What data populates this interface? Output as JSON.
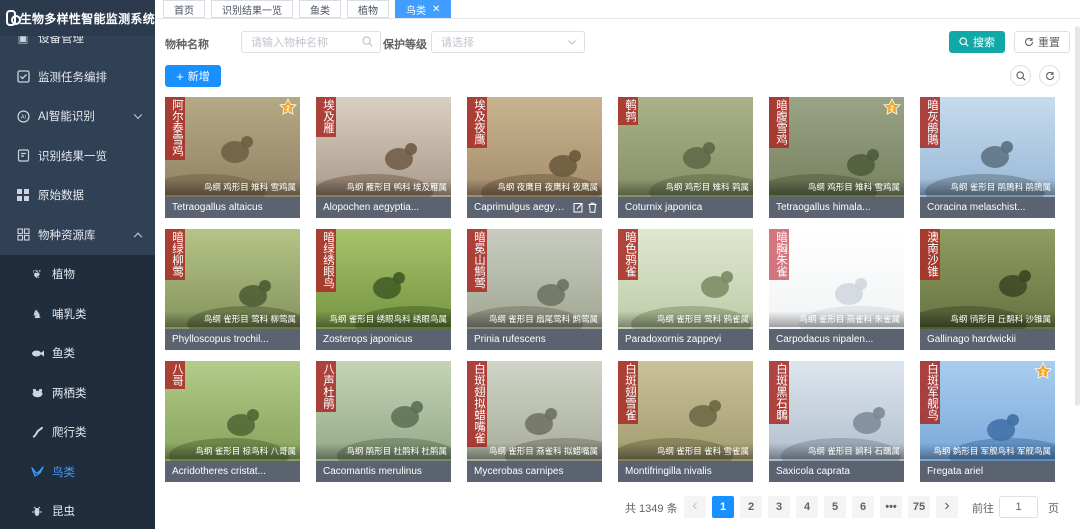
{
  "app": {
    "title": "生物多样性智能监测系统"
  },
  "sidebar": {
    "items": [
      {
        "label": "设备管理",
        "icon": "device-icon"
      },
      {
        "label": "监测任务编排",
        "icon": "task-check-icon"
      },
      {
        "label": "AI智能识别",
        "icon": "ai-icon",
        "expandable": true
      },
      {
        "label": "识别结果一览",
        "icon": "results-icon"
      },
      {
        "label": "原始数据",
        "icon": "grid-icon"
      },
      {
        "label": "物种资源库",
        "icon": "species-library-icon",
        "expanded": true
      }
    ],
    "subitems": [
      {
        "label": "植物",
        "icon": "plant-icon"
      },
      {
        "label": "哺乳类",
        "icon": "mammal-icon"
      },
      {
        "label": "鱼类",
        "icon": "fish-icon"
      },
      {
        "label": "两栖类",
        "icon": "amphibian-icon"
      },
      {
        "label": "爬行类",
        "icon": "reptile-icon"
      },
      {
        "label": "鸟类",
        "icon": "bird-icon",
        "active": true
      },
      {
        "label": "昆虫",
        "icon": "insect-icon"
      }
    ]
  },
  "tabs": [
    {
      "label": "首页"
    },
    {
      "label": "识别结果一览"
    },
    {
      "label": "鱼类"
    },
    {
      "label": "植物"
    },
    {
      "label": "鸟类",
      "active": true,
      "close": "✕"
    }
  ],
  "filters": {
    "species_label": "物种名称",
    "species_placeholder": "请输入物种名称",
    "level_label": "保护等级",
    "level_placeholder": "请选择",
    "search_button": "搜索",
    "reset_button": "重置",
    "add_button": "新增"
  },
  "cards": [
    {
      "cn": "阿尔泰雪鸡",
      "taxon": "鸟纲 鸡形目 雉科 雪鸡属",
      "latin": "Tetraogallus altaicus",
      "badge": true
    },
    {
      "cn": "埃及雁",
      "taxon": "鸟纲 雁形目 鸭科 埃及雁属",
      "latin": "Alopochen aegyptia..."
    },
    {
      "cn": "埃及夜鹰",
      "taxon": "鸟纲 夜鹰目 夜鹰科 夜鹰属",
      "latin": "Caprimulgus aegypt...",
      "hover": true
    },
    {
      "cn": "鹌鹑",
      "taxon": "鸟纲 鸡形目 雉科 鹑属",
      "latin": "Coturnix japonica"
    },
    {
      "cn": "暗腹雪鸡",
      "taxon": "鸟纲 鸡形目 雉科 雪鸡属",
      "latin": "Tetraogallus himala...",
      "badge": true
    },
    {
      "cn": "暗灰鹃鵙",
      "taxon": "鸟纲 雀形目 鹃鵙科 鹃鵙属",
      "latin": "Coracina melaschist..."
    },
    {
      "cn": "暗绿柳莺",
      "taxon": "鸟纲 雀形目 莺科 柳莺属",
      "latin": "Phylloscopus trochil..."
    },
    {
      "cn": "暗绿绣眼鸟",
      "taxon": "鸟纲 雀形目 绣眼鸟科 绣眼鸟属",
      "latin": "Zosterops japonicus"
    },
    {
      "cn": "暗冕山鹪莺",
      "taxon": "鸟纲 雀形目 扇尾莺科 鹪莺属",
      "latin": "Prinia rufescens"
    },
    {
      "cn": "暗色鸦雀",
      "taxon": "鸟纲 雀形目 莺科 鸦雀属",
      "latin": "Paradoxornis zappeyi"
    },
    {
      "cn": "暗胸朱雀",
      "taxon": "鸟纲 雀形目 燕雀科 朱雀属",
      "latin": "Carpodacus nipalen...",
      "light": true
    },
    {
      "cn": "澳南沙锥",
      "taxon": "鸟纲 鸻形目 丘鹬科 沙锥属",
      "latin": "Gallinago hardwickii"
    },
    {
      "cn": "八哥",
      "taxon": "鸟纲 雀形目 椋鸟科 八哥属",
      "latin": "Acridotheres cristat..."
    },
    {
      "cn": "八声杜鹃",
      "taxon": "鸟纲 鹃形目 杜鹃科 杜鹃属",
      "latin": "Cacomantis merulinus"
    },
    {
      "cn": "白斑翅拟蜡嘴雀",
      "taxon": "鸟纲 雀形目 燕雀科 拟蜡嘴属",
      "latin": "Mycerobas carnipes"
    },
    {
      "cn": "白斑翅雪雀",
      "taxon": "鸟纲 雀形目 雀科 雪雀属",
      "latin": "Montifringilla nivalis"
    },
    {
      "cn": "白斑黑石䳭",
      "taxon": "鸟纲 雀形目 鹟科 石䳭属",
      "latin": "Saxicola caprata"
    },
    {
      "cn": "白斑军舰鸟",
      "taxon": "鸟纲 鹈形目 军舰鸟科 军舰鸟属",
      "latin": "Fregata ariel",
      "badge": true
    }
  ],
  "pagination": {
    "total_text": "共 1349 条",
    "pages": [
      "1",
      "2",
      "3",
      "4",
      "5",
      "6",
      "•••",
      "75"
    ],
    "current": "1",
    "goto_label": "前往",
    "goto_value": "1",
    "unit_label": "页"
  },
  "colors": {
    "sidebar_bg": "#304156",
    "accent": "#409eff",
    "search_button": "#13a8a8",
    "name_tag": "#a82e28"
  }
}
